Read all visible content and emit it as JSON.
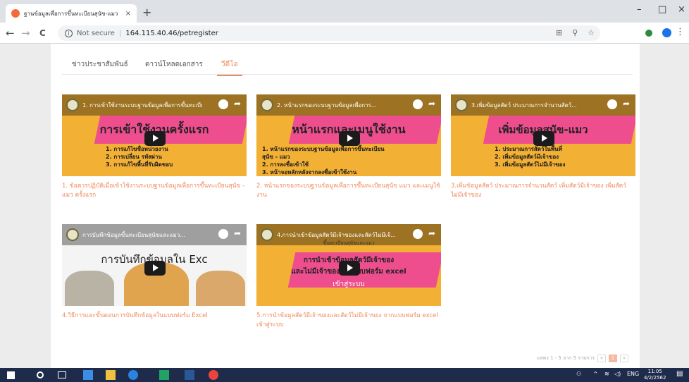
{
  "browser": {
    "tab_title": "ฐานข้อมูลเพื่อการขึ้นทะเบียนสุนัข-แมว",
    "tab_close": "×",
    "new_tab": "+",
    "security_label": "Not secure",
    "separator": "|",
    "url": "164.115.40.46/petregister",
    "nav_back": "←",
    "nav_forward": "→",
    "nav_reload": "C",
    "minimize": "–",
    "maximize": "□",
    "close": "×"
  },
  "page": {
    "tabs": [
      {
        "label": "ข่าวประชาสัมพันธ์",
        "active": false
      },
      {
        "label": "ดาวน์โหลดเอกสาร",
        "active": false
      },
      {
        "label": "วีดีโอ",
        "active": true
      }
    ],
    "videos": [
      {
        "caption": "1. การเข้าใช้งานระบบฐานข้อมูลเพื่อการขึ้นทะเบียน",
        "headline": "การเข้าใช้งานครั้งแรก",
        "bullets": [
          "1. การแก้ไขชื่อหน่วยงาน",
          "2. การเปลี่ยน รหัสผ่าน",
          "3. การแก้ไขพื้นที่รับผิดชอบ"
        ],
        "title": "1. ข้อควรปฏิบัติเมื่อเข้าใช้งานระบบฐานข้อมูลเพื่อการขึ้นทะเบียนสุนัข - แมว ครั้งแรก"
      },
      {
        "caption": "2. หน้าแรกของระบบฐานข้อมูลเพื่อการ...",
        "headline": "หน้าแรกและเมนูใช้งาน",
        "bullets": [
          "1. หน้าแรกของระบบฐานข้อมูลเพื่อการขึ้นทะเบียน",
          "สุนัข - แมว",
          "2. การลงชื่อเข้าใช้",
          "3. หน้าจอหลักหลังจากลงชื่อเข้าใช้งาน"
        ],
        "title": "2. หน้าแรกของระบบฐานข้อมูลเพื่อการขึ้นทะเบียนสุนัข แมว และเมนูใช้งาน"
      },
      {
        "caption": "3.เพิ่มข้อมูลสัตว์ ประมาณการจำนวนสัตว์...",
        "headline": "เพิ่มข้อมูลสุนัข-แมว",
        "bullets": [
          "1. ประมาณการสัตว์ในพื้นที่",
          "2. เพิ่มข้อมูลสัตว์มีเจ้าของ",
          "3. เพิ่มข้อมูลสัตว์ไม่มีเจ้าของ"
        ],
        "title": "3.เพิ่มข้อมูลสัตว์ ประมาณการจำนวนสัตว์ เพิ่มสัตว์มีเจ้าของ เพิ่มสัตว์ไม่มีเจ้าของ"
      },
      {
        "caption": "การบันทึกข้อมูลขึ้นทะเบียนสุนัขและแมว...",
        "headline": "การบันทึกข้อมูลใน Exc",
        "bullets": [],
        "title": "4.วิธีการและขั้นตอนการบันทึกข้อมูลในแบบฟอร์ม Excel"
      },
      {
        "caption": "4.การนำเข้าข้อมูลสัตว์มีเจ้าของและสัตว์ไม่มีเจ้...",
        "headline": "การนำเข้าข้อมูลสัตว์มีเจ้าของ",
        "sub_headline": "และไม่มีเจ้าของจากแบบฟอร์ม excel",
        "tag": "ขึ้นทะเบียนสุนัขและแมว",
        "bullets": [
          "เข้าสู่ระบบ"
        ],
        "title": "5.การนำข้อมูลสัตว์มีเจ้าของและสัตว์ไม่มีเจ้าของ จากแบบฟอร์ม excel เข้าสู่ระบบ"
      }
    ],
    "pager": {
      "text": "แสดง 1 - 5 จาก 5 รายการ",
      "prev": "«",
      "current": "1",
      "next": "»"
    }
  },
  "taskbar": {
    "tray_lang": "ENG",
    "time": "11:05",
    "date": "4/2/2562"
  },
  "colors": {
    "accent": "#f08a5d",
    "thumb_yellow": "#f2b035",
    "thumb_pink": "#ee4e8e",
    "taskbar": "#1f2b4a"
  }
}
